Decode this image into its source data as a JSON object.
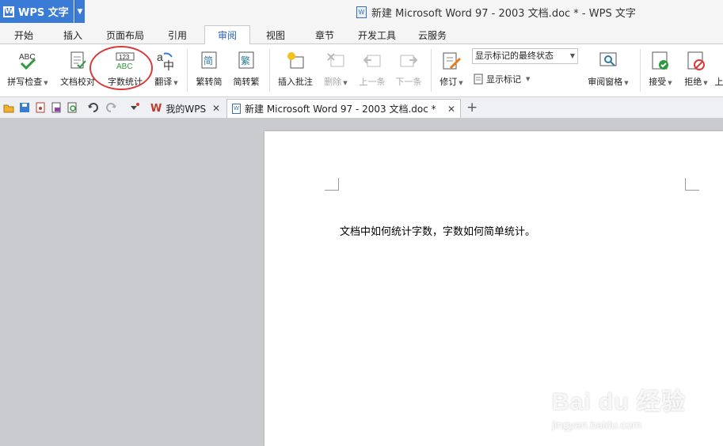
{
  "app": {
    "logo_label": "WPS 文字",
    "window_title": "新建 Microsoft Word 97 - 2003 文档.doc * - WPS 文字"
  },
  "menu": {
    "tabs": [
      "开始",
      "插入",
      "页面布局",
      "引用",
      "审阅",
      "视图",
      "章节",
      "开发工具",
      "云服务"
    ],
    "active": "审阅"
  },
  "ribbon": {
    "spell_check": "拼写检查",
    "doc_proof": "文档校对",
    "word_count": "字数统计",
    "translate": "翻译",
    "trad_to_simp": "繁转简",
    "simp_to_trad": "简转繁",
    "insert_comment": "插入批注",
    "delete": "删除",
    "prev": "上一条",
    "next": "下一条",
    "revise": "修订",
    "markup_state": "显示标记的最终状态",
    "show_markup": "显示标记",
    "review_pane": "审阅窗格",
    "accept": "接受",
    "reject": "拒绝",
    "more": "上",
    "icon_abc": "ABC",
    "icon_123": "123",
    "icon_trad": "繁",
    "icon_simp": "简"
  },
  "quick_tabs": {
    "my_wps": "我的WPS",
    "doc_name": "新建 Microsoft Word 97 - 2003 文档.doc *"
  },
  "document": {
    "body_text": "文档中如何统计字数，字数如何简单统计。"
  },
  "watermark": {
    "brand": "Bai du 经验",
    "url": "jingyan.baidu.com"
  },
  "colors": {
    "accent": "#3a7bd5",
    "annotation_red": "#d93a3a"
  }
}
